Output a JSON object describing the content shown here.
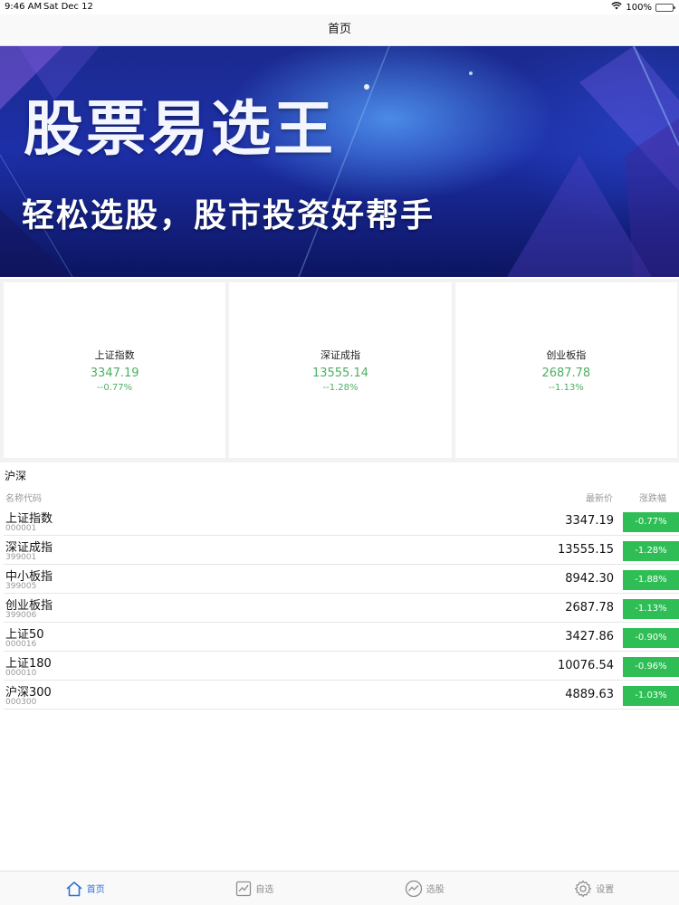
{
  "status_bar": {
    "time": "9:46 AM",
    "date": "Sat Dec 12",
    "battery": "100%"
  },
  "nav": {
    "title": "首页"
  },
  "banner": {
    "title": "股票易选王",
    "subtitle": "轻松选股，股市投资好帮手"
  },
  "index_cards": [
    {
      "name": "上证指数",
      "value": "3347.19",
      "change": "--0.77%"
    },
    {
      "name": "深证成指",
      "value": "13555.14",
      "change": "--1.28%"
    },
    {
      "name": "创业板指",
      "value": "2687.78",
      "change": "--1.13%"
    }
  ],
  "section": {
    "title": "沪深",
    "headers": {
      "name": "名称代码",
      "price": "最新价",
      "change": "涨跌幅"
    }
  },
  "stocks": [
    {
      "name": "上证指数",
      "code": "000001",
      "price": "3347.19",
      "change": "-0.77%"
    },
    {
      "name": "深证成指",
      "code": "399001",
      "price": "13555.15",
      "change": "-1.28%"
    },
    {
      "name": "中小板指",
      "code": "399005",
      "price": "8942.30",
      "change": "-1.88%"
    },
    {
      "name": "创业板指",
      "code": "399006",
      "price": "2687.78",
      "change": "-1.13%"
    },
    {
      "name": "上证50",
      "code": "000016",
      "price": "3427.86",
      "change": "-0.90%"
    },
    {
      "name": "上证180",
      "code": "000010",
      "price": "10076.54",
      "change": "-0.96%"
    },
    {
      "name": "沪深300",
      "code": "000300",
      "price": "4889.63",
      "change": "-1.03%"
    }
  ],
  "tabs": [
    {
      "label": "首页",
      "icon": "home-icon",
      "active": true
    },
    {
      "label": "自选",
      "icon": "chart-icon",
      "active": false
    },
    {
      "label": "选股",
      "icon": "trend-icon",
      "active": false
    },
    {
      "label": "设置",
      "icon": "gear-icon",
      "active": false
    }
  ],
  "colors": {
    "rise_fall_green": "#2fbe56",
    "card_text_green": "#4cb063",
    "tab_active": "#2f73d6"
  }
}
